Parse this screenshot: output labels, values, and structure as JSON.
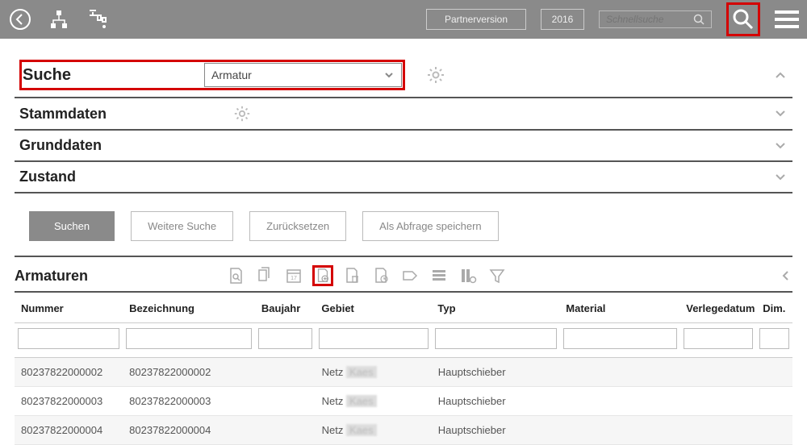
{
  "header": {
    "version_button": "Partnerversion",
    "year": "2016",
    "search_placeholder": "Schnellsuche"
  },
  "search_panel": {
    "title": "Suche",
    "dropdown_value": "Armatur",
    "sections": {
      "stammdaten": "Stammdaten",
      "grunddaten": "Grunddaten",
      "zustand": "Zustand"
    },
    "buttons": {
      "search": "Suchen",
      "more": "Weitere Suche",
      "reset": "Zurücksetzen",
      "save_query": "Als Abfrage speichern"
    }
  },
  "results": {
    "title": "Armaturen",
    "columns": {
      "num": "Nummer",
      "bez": "Bezeichnung",
      "bau": "Baujahr",
      "geb": "Gebiet",
      "typ": "Typ",
      "mat": "Material",
      "ver": "Verlegedatum",
      "dim": "Dim."
    },
    "rows": [
      {
        "num": "80237822000002",
        "bez": "80237822000002",
        "bau": "",
        "geb_prefix": "Netz",
        "geb_blur": "Kaes",
        "typ": "Hauptschieber",
        "mat": "",
        "ver": "",
        "dim": ""
      },
      {
        "num": "80237822000003",
        "bez": "80237822000003",
        "bau": "",
        "geb_prefix": "Netz",
        "geb_blur": "Kaes",
        "typ": "Hauptschieber",
        "mat": "",
        "ver": "",
        "dim": ""
      },
      {
        "num": "80237822000004",
        "bez": "80237822000004",
        "bau": "",
        "geb_prefix": "Netz",
        "geb_blur": "Kaes",
        "typ": "Hauptschieber",
        "mat": "",
        "ver": "",
        "dim": ""
      }
    ]
  }
}
